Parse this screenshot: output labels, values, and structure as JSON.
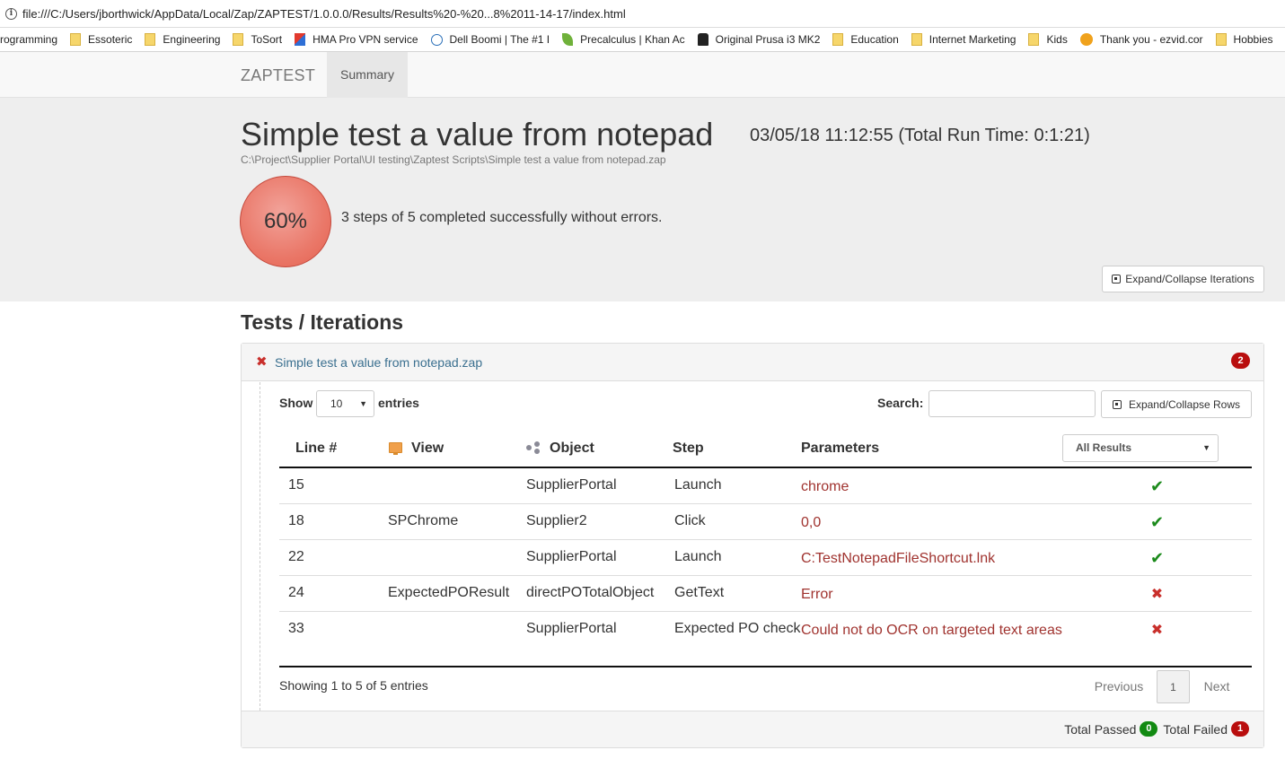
{
  "browser": {
    "url": "file:///C:/Users/jborthwick/AppData/Local/Zap/ZAPTEST/1.0.0.0/Results/Results%20-%20...8%2011-14-17/index.html",
    "bookmarks": [
      {
        "label": "rogramming",
        "icon": "none"
      },
      {
        "label": "Essoteric",
        "icon": "folder-icon"
      },
      {
        "label": "Engineering",
        "icon": "folder-icon"
      },
      {
        "label": "ToSort",
        "icon": "folder-icon"
      },
      {
        "label": "HMA Pro VPN service",
        "icon": "hma-icon"
      },
      {
        "label": "Dell Boomi | The #1 I",
        "icon": "dell-icon"
      },
      {
        "label": "Precalculus | Khan Ac",
        "icon": "leaf-icon"
      },
      {
        "label": "Original Prusa i3 MK2",
        "icon": "prusa-icon"
      },
      {
        "label": "Education",
        "icon": "folder-icon"
      },
      {
        "label": "Internet Marketing",
        "icon": "folder-icon"
      },
      {
        "label": "Kids",
        "icon": "folder-icon"
      },
      {
        "label": "Thank you - ezvid.cor",
        "icon": "play-icon"
      },
      {
        "label": "Hobbies",
        "icon": "folder-icon"
      }
    ]
  },
  "nav": {
    "brand": "ZAPTEST",
    "tab_summary": "Summary"
  },
  "header": {
    "title": "Simple test a value from notepad",
    "runtime": "03/05/18 11:12:55 (Total Run Time: 0:1:21)",
    "path": "C:\\Project\\Supplier Portal\\UI testing\\Zaptest Scripts\\Simple test a value from notepad.zap",
    "percent": "60%",
    "percent_value": 60,
    "summary": "3 steps of 5 completed successfully without errors.",
    "expand_iterations": "Expand/Collapse Iterations"
  },
  "tests": {
    "section_title": "Tests / Iterations",
    "panel_title": "Simple test a value from notepad.zap",
    "panel_badge": "2",
    "show_label": "Show",
    "page_length": "10",
    "entries_label": "entries",
    "search_label": "Search:",
    "search_value": "",
    "expand_rows": "Expand/Collapse Rows",
    "filter_selected": "All Results",
    "columns": {
      "line": "Line #",
      "view": "View",
      "object": "Object",
      "step": "Step",
      "parameters": "Parameters"
    },
    "rows": [
      {
        "line": "15",
        "view": "",
        "object": "SupplierPortal",
        "step": "Launch",
        "parameters": "chrome",
        "result": "pass"
      },
      {
        "line": "18",
        "view": "SPChrome",
        "object": "Supplier2",
        "step": "Click",
        "parameters": "0,0",
        "result": "pass"
      },
      {
        "line": "22",
        "view": "",
        "object": "SupplierPortal",
        "step": "Launch",
        "parameters": "C:TestNotepadFileShortcut.lnk",
        "result": "pass"
      },
      {
        "line": "24",
        "view": "ExpectedPOResult",
        "object": "directPOTotalObject",
        "step": "GetText",
        "parameters": "Error",
        "result": "fail"
      },
      {
        "line": "33",
        "view": "",
        "object": "SupplierPortal",
        "step": "Expected PO check",
        "parameters": "Could not do OCR on targeted text areas",
        "result": "fail"
      }
    ],
    "info": "Showing 1 to 5 of 5 entries",
    "pager": {
      "previous": "Previous",
      "page": "1",
      "next": "Next"
    },
    "footer": {
      "total_passed_label": "Total Passed",
      "total_passed": "0",
      "total_failed_label": "Total Failed",
      "total_failed": "1"
    }
  },
  "colors": {
    "pass": "#1b8a1b",
    "fail": "#c9302c",
    "param_text": "#a0332f",
    "badge_green": "#128a12",
    "badge_red": "#b90e0e"
  }
}
